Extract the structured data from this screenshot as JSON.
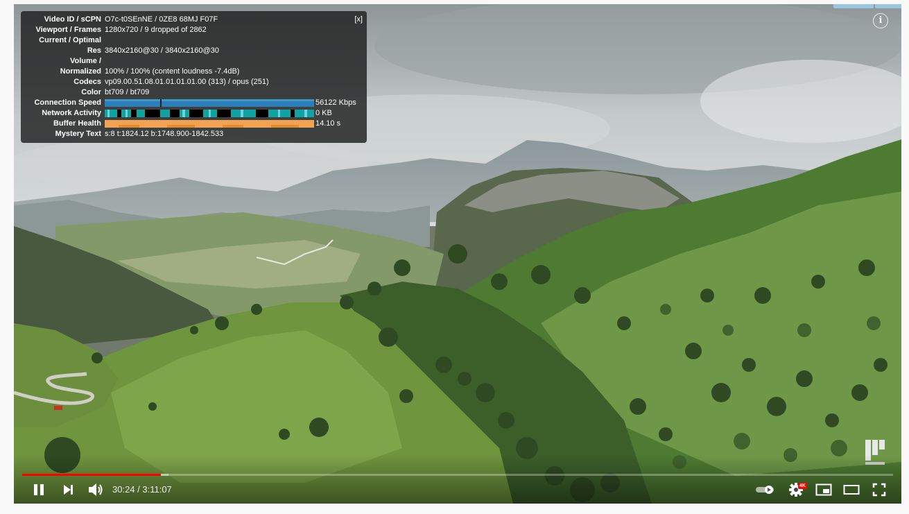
{
  "stats": {
    "close_label": "[x]",
    "rows": [
      {
        "label": "Video ID / sCPN",
        "value": "O7c-t0SEnNE / 0ZE8 68MJ F07F"
      },
      {
        "label": "Viewport / Frames",
        "value": "1280x720 / 9 dropped of 2862"
      },
      {
        "label": "Current / Optimal",
        "value": ""
      },
      {
        "label": "Res",
        "value": "3840x2160@30 / 3840x2160@30"
      },
      {
        "label": "Volume /",
        "value": ""
      },
      {
        "label": "Normalized",
        "value": "100% / 100% (content loudness -7.4dB)"
      },
      {
        "label": "Codecs",
        "value": "vp09.00.51.08.01.01.01.01.00 (313) / opus (251)"
      },
      {
        "label": "Color",
        "value": "bt709 / bt709"
      }
    ],
    "connection_speed": {
      "label": "Connection Speed",
      "value": "56122 Kbps"
    },
    "network_activity": {
      "label": "Network Activity",
      "value": "0 KB"
    },
    "buffer_health": {
      "label": "Buffer Health",
      "value": "14.10 s"
    },
    "mystery_text": {
      "label": "Mystery Text",
      "value": "s:8 t:1824.12 b:1748.900-1842.533"
    }
  },
  "info_button": {
    "glyph": "i",
    "icon": "info-icon"
  },
  "player": {
    "current_time": "30:24",
    "duration": "3:11:07",
    "time_display": "30:24 / 3:11:07",
    "progress_fraction": 0.159,
    "buffered_start_fraction": 0.159,
    "buffered_end_fraction": 0.168,
    "quality_badge": "4K"
  },
  "controls": {
    "play_pause_icon": "pause-icon",
    "next_icon": "next-icon",
    "volume_icon": "volume-icon",
    "autoplay_icon": "autoplay-toggle",
    "settings_icon": "gear-icon",
    "miniplayer_icon": "miniplayer-icon",
    "theater_icon": "theater-mode-icon",
    "fullscreen_icon": "fullscreen-icon"
  },
  "colors": {
    "progress_played": "#ff0000",
    "badge": "#ff0000",
    "stats_bg": "#1c1c1c"
  }
}
